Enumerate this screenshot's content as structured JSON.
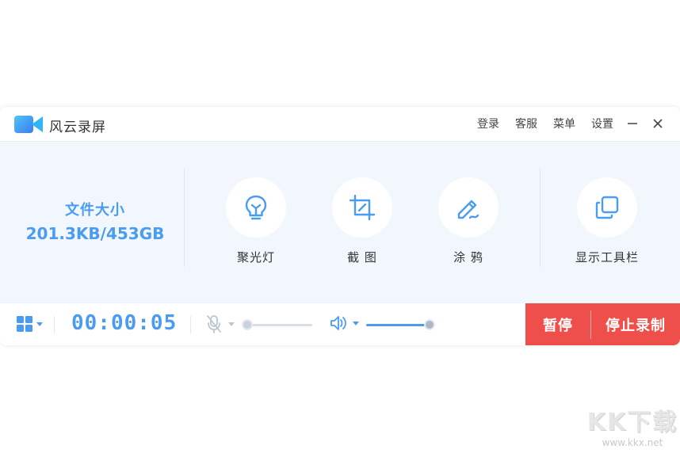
{
  "app": {
    "title": "风云录屏",
    "colors": {
      "accent": "#4a9cf0",
      "danger": "#ef4f4a",
      "panel": "#f1f7fc"
    }
  },
  "titlebar": {
    "links": [
      "登录",
      "客服",
      "菜单",
      "设置"
    ],
    "minimize_icon": "minimize-icon",
    "close_icon": "close-icon"
  },
  "file_size": {
    "label": "文件大小",
    "value": "201.3KB/453GB"
  },
  "tools": [
    {
      "label": "聚光灯",
      "icon": "lightbulb-icon"
    },
    {
      "label": "截 图",
      "icon": "crop-icon"
    },
    {
      "label": "涂 鸦",
      "icon": "pen-icon"
    },
    {
      "label": "显示工具栏",
      "icon": "copy-icon"
    }
  ],
  "bottom": {
    "timer": "00:00:05",
    "mic_level": 0,
    "volume_level": 1.0,
    "pause_label": "暂停",
    "stop_label": "停止录制"
  },
  "watermark": {
    "logo_text": "KK下载",
    "url": "www.kkx.net"
  }
}
